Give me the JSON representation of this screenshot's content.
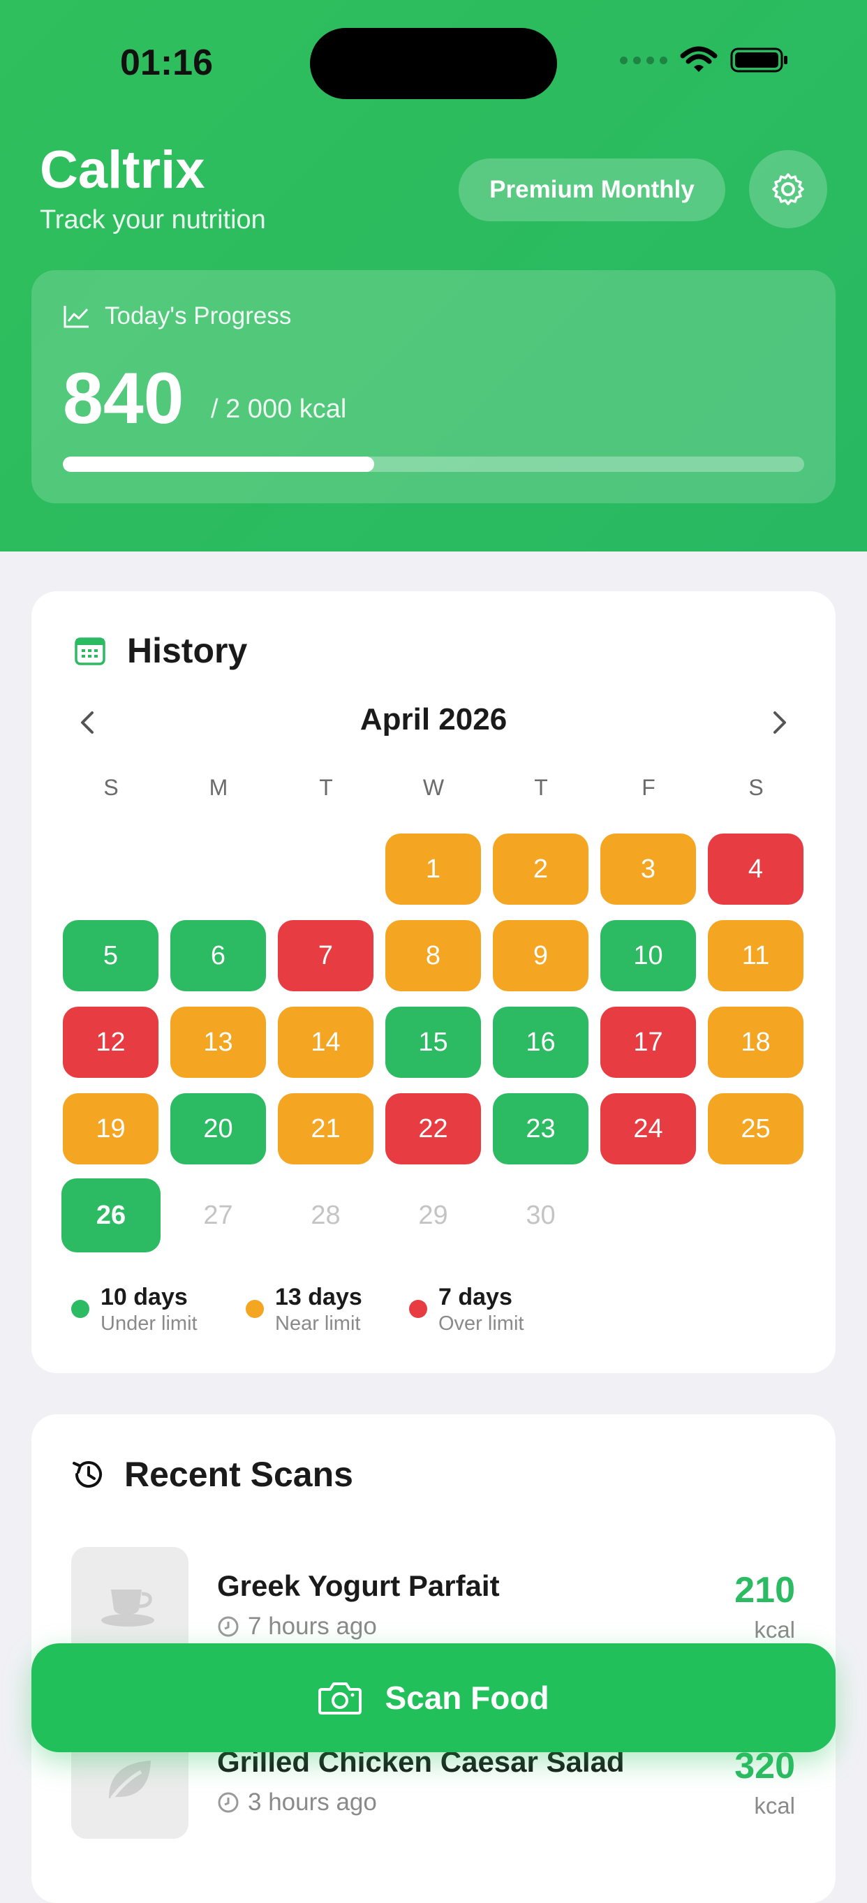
{
  "status_bar": {
    "time": "01:16"
  },
  "header": {
    "app_title": "Caltrix",
    "subtitle": "Track your nutrition",
    "plan_button": "Premium Monthly"
  },
  "progress": {
    "label": "Today's Progress",
    "value": "840",
    "goal": "/ 2 000 kcal",
    "fraction": 0.42
  },
  "history": {
    "title": "History",
    "month": "April 2026",
    "weekdays": [
      "S",
      "M",
      "T",
      "W",
      "T",
      "F",
      "S"
    ],
    "days": [
      {
        "n": "1",
        "status": "orange"
      },
      {
        "n": "2",
        "status": "orange"
      },
      {
        "n": "3",
        "status": "orange"
      },
      {
        "n": "4",
        "status": "red"
      },
      {
        "n": "5",
        "status": "green"
      },
      {
        "n": "6",
        "status": "green"
      },
      {
        "n": "7",
        "status": "red"
      },
      {
        "n": "8",
        "status": "orange"
      },
      {
        "n": "9",
        "status": "orange"
      },
      {
        "n": "10",
        "status": "green"
      },
      {
        "n": "11",
        "status": "orange"
      },
      {
        "n": "12",
        "status": "red"
      },
      {
        "n": "13",
        "status": "orange"
      },
      {
        "n": "14",
        "status": "orange"
      },
      {
        "n": "15",
        "status": "green"
      },
      {
        "n": "16",
        "status": "green"
      },
      {
        "n": "17",
        "status": "red"
      },
      {
        "n": "18",
        "status": "orange"
      },
      {
        "n": "19",
        "status": "orange"
      },
      {
        "n": "20",
        "status": "green"
      },
      {
        "n": "21",
        "status": "orange"
      },
      {
        "n": "22",
        "status": "red"
      },
      {
        "n": "23",
        "status": "green"
      },
      {
        "n": "24",
        "status": "red"
      },
      {
        "n": "25",
        "status": "orange"
      },
      {
        "n": "26",
        "status": "today"
      },
      {
        "n": "27",
        "status": "future"
      },
      {
        "n": "28",
        "status": "future"
      },
      {
        "n": "29",
        "status": "future"
      },
      {
        "n": "30",
        "status": "future"
      }
    ],
    "legend": [
      {
        "count": "10 days",
        "desc": "Under limit",
        "color": "#2cbb62"
      },
      {
        "count": "13 days",
        "desc": "Near limit",
        "color": "#f4a623"
      },
      {
        "count": "7 days",
        "desc": "Over limit",
        "color": "#e73d42"
      }
    ]
  },
  "recent": {
    "title": "Recent Scans",
    "items": [
      {
        "name": "Greek Yogurt Parfait",
        "time": "7 hours ago",
        "kcal": "210",
        "unit": "kcal",
        "icon": "cup-icon"
      },
      {
        "name": "Grilled Chicken Caesar Salad",
        "time": "3 hours ago",
        "kcal": "320",
        "unit": "kcal",
        "icon": "leaf-icon"
      }
    ]
  },
  "scan_button": {
    "label": "Scan Food"
  },
  "colors": {
    "brand": "#2cbb62",
    "under": "#2cbb62",
    "near": "#f4a623",
    "over": "#e73d42"
  }
}
